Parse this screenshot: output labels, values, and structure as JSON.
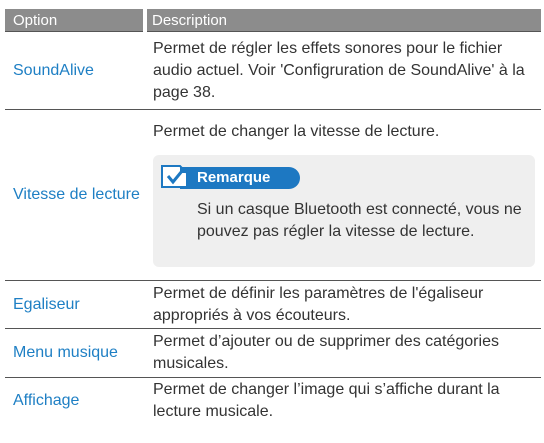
{
  "table": {
    "headers": {
      "option": "Option",
      "description": "Description"
    },
    "rows": [
      {
        "option": "SoundAlive",
        "description": "Permet de régler les effets sonores pour le fichier audio actuel. Voir 'Configruration de SoundAlive' à la page 38."
      },
      {
        "option": "Vitesse de lecture",
        "description": "Permet de changer la vitesse de lecture.",
        "note": {
          "title": "Remarque",
          "text": "Si un casque Bluetooth est connecté, vous ne pouvez pas régler la vitesse de lecture."
        }
      },
      {
        "option": "Egaliseur",
        "description": "Permet de définir les paramètres de l'égaliseur appropriés à vos écouteurs."
      },
      {
        "option": "Menu musique",
        "description": "Permet d’ajouter ou de supprimer des catégories musicales."
      },
      {
        "option": "Affichage",
        "description": "Permet de changer l’image qui s’affiche durant la lecture musicale."
      }
    ]
  },
  "colors": {
    "header_bg": "#8c8c8c",
    "option_text": "#1e7fc4",
    "note_bg": "#efefef",
    "note_badge": "#1d78c2"
  },
  "icons": {
    "note": "note-check-icon"
  }
}
